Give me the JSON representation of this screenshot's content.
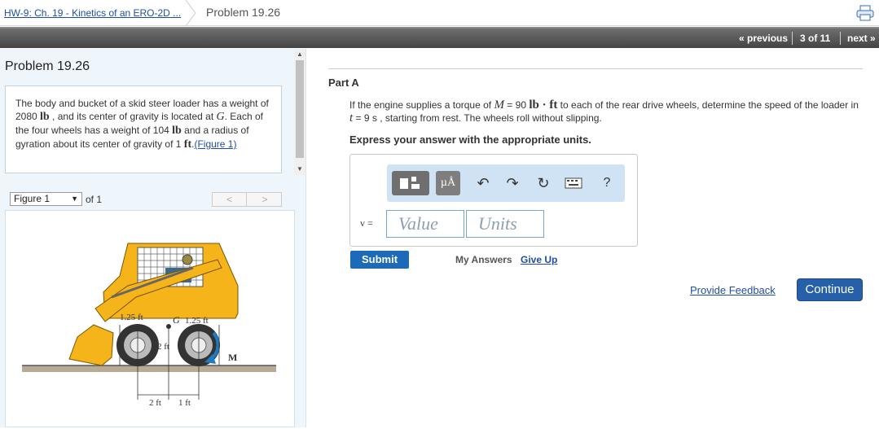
{
  "breadcrumb": {
    "assignment_link": "HW-9: Ch. 19 - Kinetics of an ERO-2D ...",
    "current": "Problem 19.26"
  },
  "nav": {
    "previous": "« previous",
    "position": "3 of 11",
    "next": "next »"
  },
  "problem": {
    "title": "Problem 19.26",
    "text_1": "The body and bucket of a skid steer loader has a weight of 2080 ",
    "unit_lb": "lb",
    "text_2": " , and its center of gravity is located at ",
    "G": "G",
    "text_3": ". Each of the four wheels has a weight of 104 ",
    "text_4": " and a radius of gyration about its center of gravity of 1 ",
    "unit_ft": "ft",
    "text_5": ".",
    "figure_link": "(Figure 1)"
  },
  "figure": {
    "select_value": "Figure 1",
    "of_label": "of 1",
    "labels": {
      "d1": "1.25 ft",
      "g": "G",
      "d2": "1.25 ft",
      "d3": "2 ft",
      "m": "M",
      "b1": "2 ft",
      "b2": "1 ft"
    }
  },
  "part": {
    "title": "Part A",
    "q1": "If the engine supplies a torque of ",
    "M": "M",
    "q2": " = 90 ",
    "unit_lbft": "lb · ft",
    "q3": " to each of the rear drive wheels, determine the speed of the loader in ",
    "t": "t",
    "q4": " = 9 s , starting from rest. The wheels roll without slipping.",
    "instruction": "Express your answer with the appropriate units.",
    "var_label": "v =",
    "value_placeholder": "Value",
    "units_placeholder": "Units",
    "units_button": "µÅ",
    "help_button": "?"
  },
  "actions": {
    "submit": "Submit",
    "my_answers": "My Answers",
    "give_up": "Give Up",
    "feedback": "Provide Feedback",
    "continue": "Continue"
  },
  "colors": {
    "accent": "#1c6ab8",
    "nav_bg": "#555555",
    "left_pane": "#eef6fb",
    "loader": "#f4b41a"
  }
}
